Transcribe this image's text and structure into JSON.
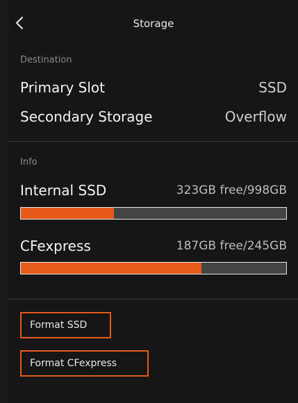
{
  "header": {
    "title": "Storage"
  },
  "destination": {
    "section_label": "Destination",
    "primary": {
      "label": "Primary Slot",
      "value": "SSD"
    },
    "secondary": {
      "label": "Secondary Storage",
      "value": "Overflow"
    }
  },
  "info": {
    "section_label": "Info",
    "internal": {
      "label": "Internal SSD",
      "value": "323GB free/998GB",
      "used_fraction": 0.35
    },
    "cfexpress": {
      "label": "CFexpress",
      "value": "187GB free/245GB",
      "used_fraction": 0.68
    }
  },
  "actions": {
    "format_ssd": "Format SSD",
    "format_cfexpress": "Format CFexpress"
  },
  "colors": {
    "accent": "#e65a1a",
    "bar_track": "#444444"
  },
  "icons": {
    "back": "chevron-left-icon"
  }
}
